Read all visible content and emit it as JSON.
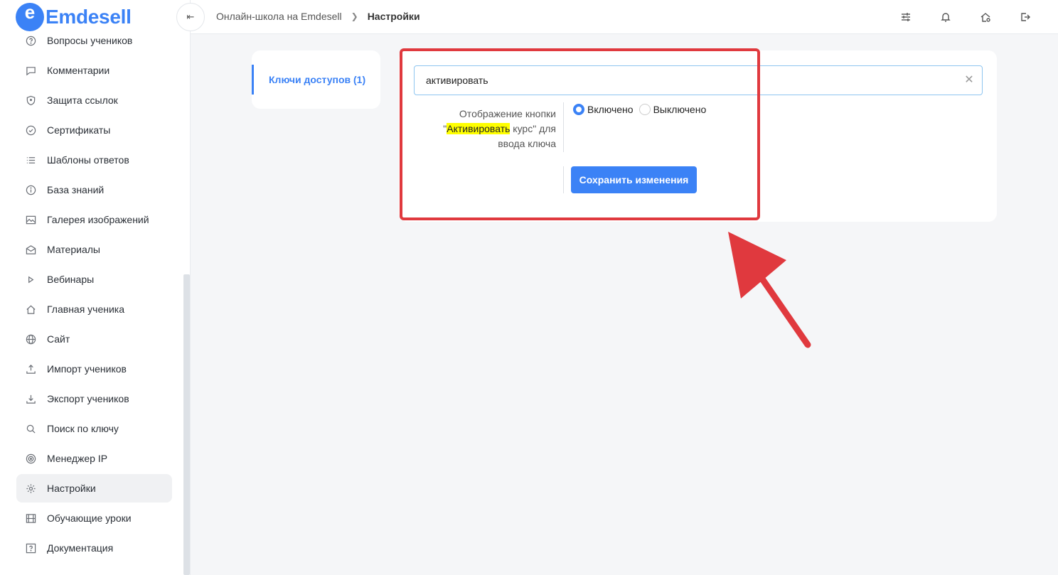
{
  "brand": {
    "logo_letter": "e",
    "name": "Emdesell",
    "accent": "#3b82f6"
  },
  "sidebar": {
    "items": [
      {
        "label": "Вопросы учеников",
        "icon": "question-circle-icon"
      },
      {
        "label": "Комментарии",
        "icon": "comment-icon"
      },
      {
        "label": "Защита ссылок",
        "icon": "shield-icon"
      },
      {
        "label": "Сертификаты",
        "icon": "check-circle-icon"
      },
      {
        "label": "Шаблоны ответов",
        "icon": "list-icon"
      },
      {
        "label": "База знаний",
        "icon": "info-circle-icon"
      },
      {
        "label": "Галерея изображений",
        "icon": "image-icon"
      },
      {
        "label": "Материалы",
        "icon": "envelope-open-icon"
      },
      {
        "label": "Вебинары",
        "icon": "play-icon"
      },
      {
        "label": "Главная ученика",
        "icon": "home-icon"
      },
      {
        "label": "Сайт",
        "icon": "globe-icon"
      },
      {
        "label": "Импорт учеников",
        "icon": "upload-icon"
      },
      {
        "label": "Экспорт учеников",
        "icon": "download-icon"
      },
      {
        "label": "Поиск по ключу",
        "icon": "search-icon"
      },
      {
        "label": "Менеджер IP",
        "icon": "target-icon"
      },
      {
        "label": "Настройки",
        "icon": "gear-icon",
        "active": true
      },
      {
        "label": "Обучающие уроки",
        "icon": "film-icon"
      },
      {
        "label": "Документация",
        "icon": "question-square-icon"
      }
    ]
  },
  "topbar": {
    "collapse_glyph": "⇤",
    "breadcrumb": {
      "parent": "Онлайн-школа на Emdesell",
      "current": "Настройки"
    },
    "icons": [
      "sliders-icon",
      "bell-icon",
      "home-gear-icon",
      "logout-icon"
    ]
  },
  "tabs": {
    "active_label": "Ключи доступов (1)"
  },
  "settings": {
    "search_value": "активировать",
    "label_before": "Отображение кнопки \"",
    "label_highlight": "Активировать",
    "label_after": " курс\" для ввода ключа",
    "radio_on": "Включено",
    "radio_off": "Выключено",
    "save_label": "Сохранить изменения"
  }
}
